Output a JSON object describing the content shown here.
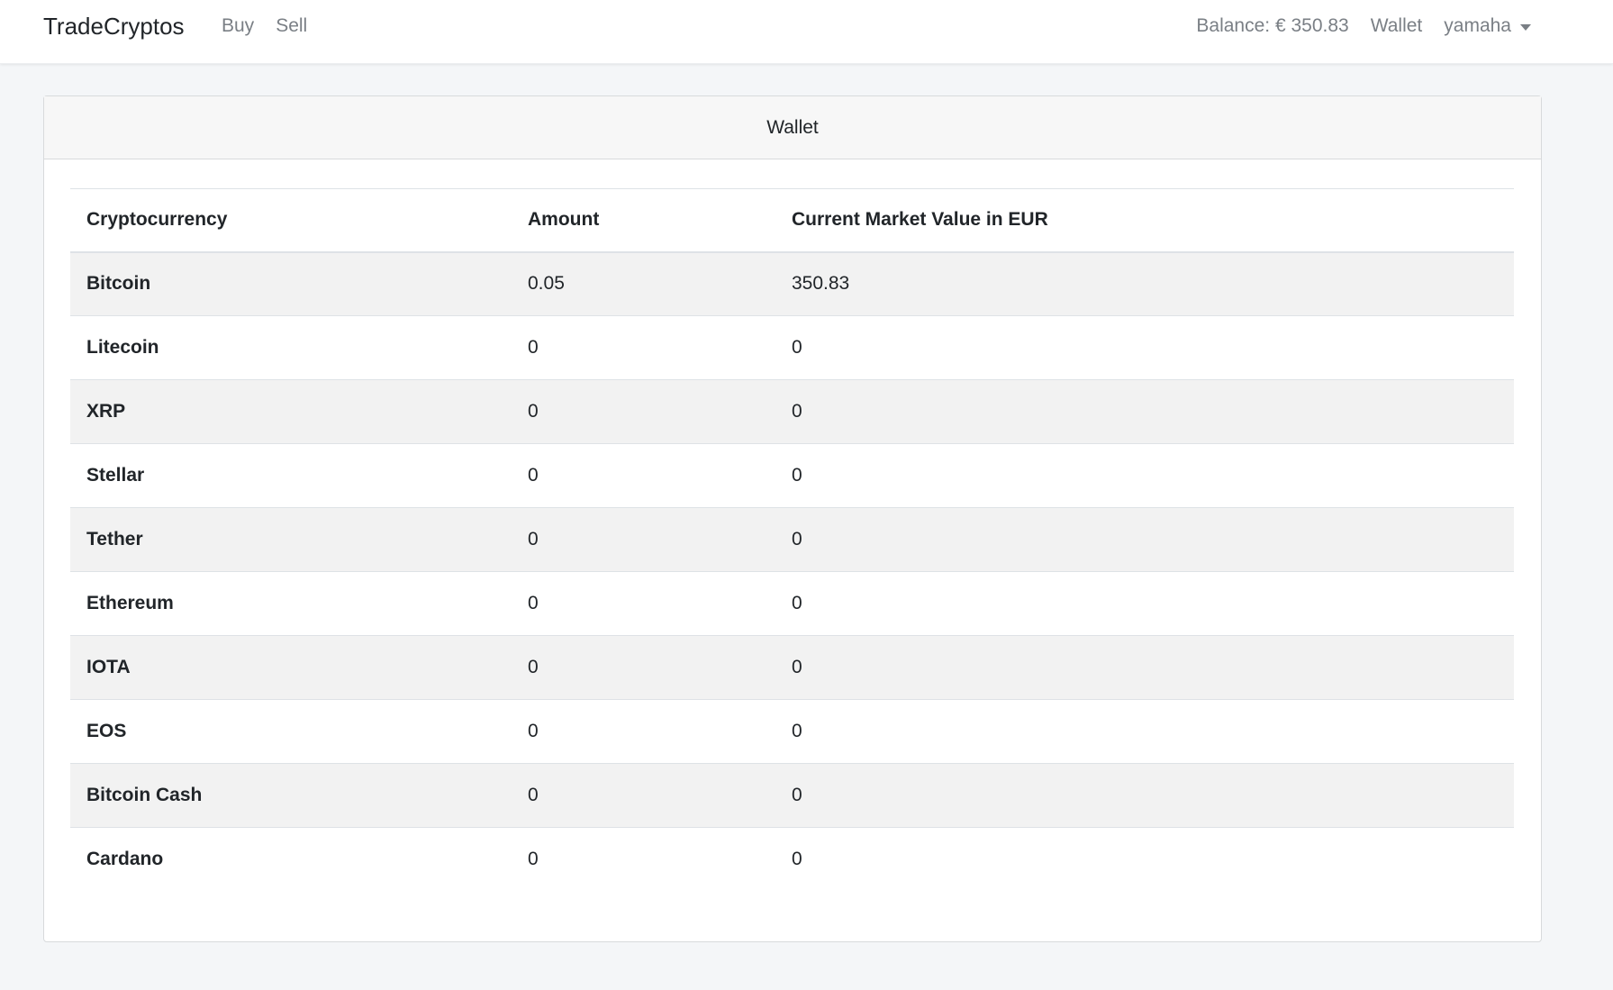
{
  "navbar": {
    "brand": "TradeCryptos",
    "links": [
      "Buy",
      "Sell"
    ],
    "balance": "Balance: € 350.83",
    "wallet_link": "Wallet",
    "user": "yamaha"
  },
  "card": {
    "title": "Wallet"
  },
  "table": {
    "headers": [
      "Cryptocurrency",
      "Amount",
      "Current Market Value in EUR"
    ],
    "rows": [
      {
        "name": "Bitcoin",
        "amount": "0.05",
        "value": "350.83"
      },
      {
        "name": "Litecoin",
        "amount": "0",
        "value": "0"
      },
      {
        "name": "XRP",
        "amount": "0",
        "value": "0"
      },
      {
        "name": "Stellar",
        "amount": "0",
        "value": "0"
      },
      {
        "name": "Tether",
        "amount": "0",
        "value": "0"
      },
      {
        "name": "Ethereum",
        "amount": "0",
        "value": "0"
      },
      {
        "name": "IOTA",
        "amount": "0",
        "value": "0"
      },
      {
        "name": "EOS",
        "amount": "0",
        "value": "0"
      },
      {
        "name": "Bitcoin Cash",
        "amount": "0",
        "value": "0"
      },
      {
        "name": "Cardano",
        "amount": "0",
        "value": "0"
      }
    ]
  },
  "colors": {
    "background": "#f4f6f8",
    "navbar": "#ffffff",
    "muted_text": "#7a7f85",
    "stripe": "#f2f2f2"
  }
}
